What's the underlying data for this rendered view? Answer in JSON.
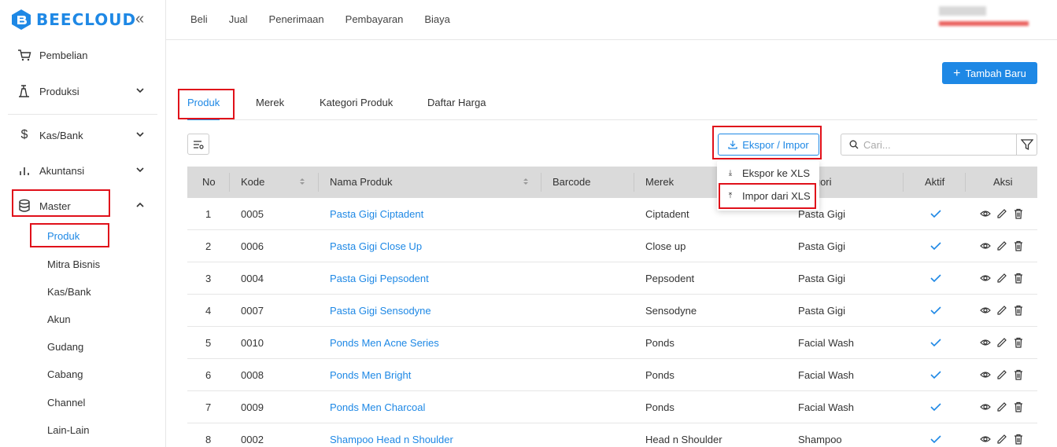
{
  "app": {
    "logo_text": "BEECLOUD",
    "accent": "#1e88e5"
  },
  "sidebar": {
    "items": [
      {
        "label": "Pembelian",
        "icon": "cart-icon"
      },
      {
        "label": "Produksi",
        "icon": "factory-icon"
      },
      {
        "label": "Kas/Bank",
        "icon": "dollar-icon"
      },
      {
        "label": "Akuntansi",
        "icon": "bar-chart-icon"
      },
      {
        "label": "Master",
        "icon": "database-icon"
      }
    ],
    "master_sub": [
      "Produk",
      "Mitra Bisnis",
      "Kas/Bank",
      "Akun",
      "Gudang",
      "Cabang",
      "Channel",
      "Lain-Lain"
    ]
  },
  "topnav": [
    "Beli",
    "Jual",
    "Penerimaan",
    "Pembayaran",
    "Biaya"
  ],
  "main": {
    "add_button": "Tambah Baru",
    "tabs": [
      "Produk",
      "Merek",
      "Kategori Produk",
      "Daftar Harga"
    ],
    "export_button": "Ekspor / Impor",
    "search_placeholder": "Cari...",
    "dropdown": [
      "Ekspor ke XLS",
      "Impor dari XLS"
    ]
  },
  "table": {
    "columns": [
      "No",
      "Kode",
      "Nama Produk",
      "Barcode",
      "Merek",
      "Kategori",
      "Aktif",
      "Aksi"
    ],
    "category_visible": "tegori",
    "rows": [
      {
        "no": "1",
        "kode": "0005",
        "nama": "Pasta Gigi Ciptadent",
        "barcode": "",
        "merek": "Ciptadent",
        "kategori": "Pasta Gigi"
      },
      {
        "no": "2",
        "kode": "0006",
        "nama": "Pasta Gigi Close Up",
        "barcode": "",
        "merek": "Close up",
        "kategori": "Pasta Gigi"
      },
      {
        "no": "3",
        "kode": "0004",
        "nama": "Pasta Gigi Pepsodent",
        "barcode": "",
        "merek": "Pepsodent",
        "kategori": "Pasta Gigi"
      },
      {
        "no": "4",
        "kode": "0007",
        "nama": "Pasta Gigi Sensodyne",
        "barcode": "",
        "merek": "Sensodyne",
        "kategori": "Pasta Gigi"
      },
      {
        "no": "5",
        "kode": "0010",
        "nama": "Ponds Men Acne Series",
        "barcode": "",
        "merek": "Ponds",
        "kategori": "Facial Wash"
      },
      {
        "no": "6",
        "kode": "0008",
        "nama": "Ponds Men Bright",
        "barcode": "",
        "merek": "Ponds",
        "kategori": "Facial Wash"
      },
      {
        "no": "7",
        "kode": "0009",
        "nama": "Ponds Men Charcoal",
        "barcode": "",
        "merek": "Ponds",
        "kategori": "Facial Wash"
      },
      {
        "no": "8",
        "kode": "0002",
        "nama": "Shampoo Head n Shoulder",
        "barcode": "",
        "merek": "Head n Shoulder",
        "kategori": "Shampoo"
      }
    ]
  }
}
